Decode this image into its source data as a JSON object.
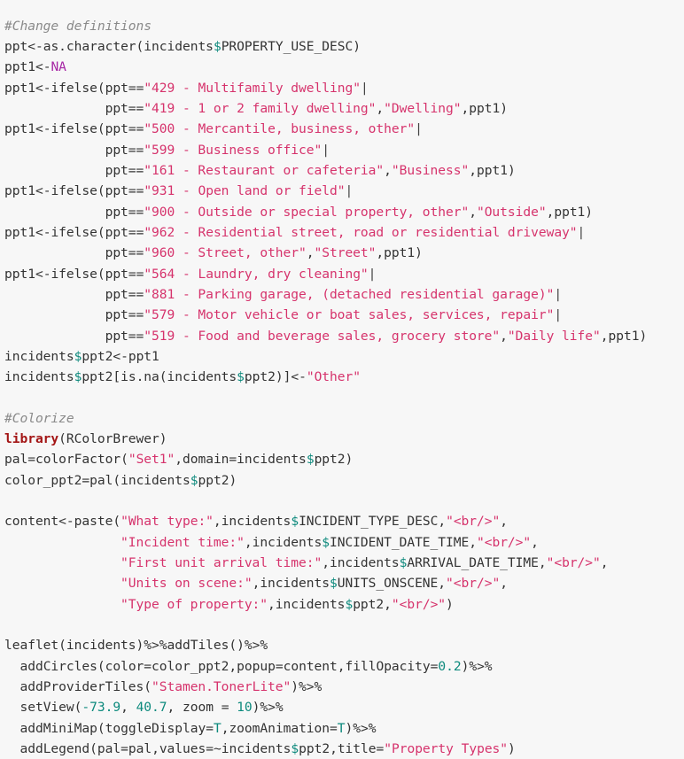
{
  "editor": {
    "language": "R",
    "background_color": "#f7f7f7",
    "default_text_color": "#333333",
    "syntax_colors": {
      "comment": "#8a8a8a",
      "string": "#d6336c",
      "keyword": "#a31515",
      "constant_na": "#a626a4",
      "dollar_operator": "#0e8a7d",
      "number": "#0d8a7d",
      "pipe_separator": "#444444"
    }
  },
  "code": {
    "lines": [
      {
        "id": "l1",
        "text": "#Change definitions"
      },
      {
        "id": "l2",
        "text": "ppt<-as.character(incidents$PROPERTY_USE_DESC)"
      },
      {
        "id": "l3",
        "text": "ppt1<-NA"
      },
      {
        "id": "l4",
        "text": "ppt1<-ifelse(ppt==\"429 - Multifamily dwelling\"|"
      },
      {
        "id": "l5",
        "text": "             ppt==\"419 - 1 or 2 family dwelling\",\"Dwelling\",ppt1)"
      },
      {
        "id": "l6",
        "text": "ppt1<-ifelse(ppt==\"500 - Mercantile, business, other\"|"
      },
      {
        "id": "l7",
        "text": "             ppt==\"599 - Business office\"|"
      },
      {
        "id": "l8",
        "text": "             ppt==\"161 - Restaurant or cafeteria\",\"Business\",ppt1)"
      },
      {
        "id": "l9",
        "text": "ppt1<-ifelse(ppt==\"931 - Open land or field\"|"
      },
      {
        "id": "l10",
        "text": "             ppt==\"900 - Outside or special property, other\",\"Outside\",ppt1)"
      },
      {
        "id": "l11",
        "text": "ppt1<-ifelse(ppt==\"962 - Residential street, road or residential driveway\"|"
      },
      {
        "id": "l12",
        "text": "             ppt==\"960 - Street, other\",\"Street\",ppt1)"
      },
      {
        "id": "l13",
        "text": "ppt1<-ifelse(ppt==\"564 - Laundry, dry cleaning\"|"
      },
      {
        "id": "l14",
        "text": "             ppt==\"881 - Parking garage, (detached residential garage)\"|"
      },
      {
        "id": "l15",
        "text": "             ppt==\"579 - Motor vehicle or boat sales, services, repair\"|"
      },
      {
        "id": "l16",
        "text": "             ppt==\"519 - Food and beverage sales, grocery store\",\"Daily life\",ppt1)"
      },
      {
        "id": "l17",
        "text": "incidents$ppt2<-ppt1"
      },
      {
        "id": "l18",
        "text": "incidents$ppt2[is.na(incidents$ppt2)]<-\"Other\""
      },
      {
        "id": "l19",
        "text": ""
      },
      {
        "id": "l20",
        "text": "#Colorize"
      },
      {
        "id": "l21",
        "text": "library(RColorBrewer)"
      },
      {
        "id": "l22",
        "text": "pal=colorFactor(\"Set1\",domain=incidents$ppt2)"
      },
      {
        "id": "l23",
        "text": "color_ppt2=pal(incidents$ppt2)"
      },
      {
        "id": "l24",
        "text": ""
      },
      {
        "id": "l25",
        "text": "content<-paste(\"What type:\",incidents$INCIDENT_TYPE_DESC,\"<br/>\","
      },
      {
        "id": "l26",
        "text": "               \"Incident time:\",incidents$INCIDENT_DATE_TIME,\"<br/>\","
      },
      {
        "id": "l27",
        "text": "               \"First unit arrival time:\",incidents$ARRIVAL_DATE_TIME,\"<br/>\","
      },
      {
        "id": "l28",
        "text": "               \"Units on scene:\",incidents$UNITS_ONSCENE,\"<br/>\","
      },
      {
        "id": "l29",
        "text": "               \"Type of property:\",incidents$ppt2,\"<br/>\")"
      },
      {
        "id": "l30",
        "text": ""
      },
      {
        "id": "l31",
        "text": "leaflet(incidents)%>%addTiles()%>%"
      },
      {
        "id": "l32",
        "text": "  addCircles(color=color_ppt2,popup=content,fillOpacity=0.2)%>%"
      },
      {
        "id": "l33",
        "text": "  addProviderTiles(\"Stamen.TonerLite\")%>%"
      },
      {
        "id": "l34",
        "text": "  setView(-73.9, 40.7, zoom = 10)%>%"
      },
      {
        "id": "l35",
        "text": "  addMiniMap(toggleDisplay=T,zoomAnimation=T)%>%"
      },
      {
        "id": "l36",
        "text": "  addLegend(pal=pal,values=~incidents$ppt2,title=\"Property Types\")"
      }
    ]
  }
}
